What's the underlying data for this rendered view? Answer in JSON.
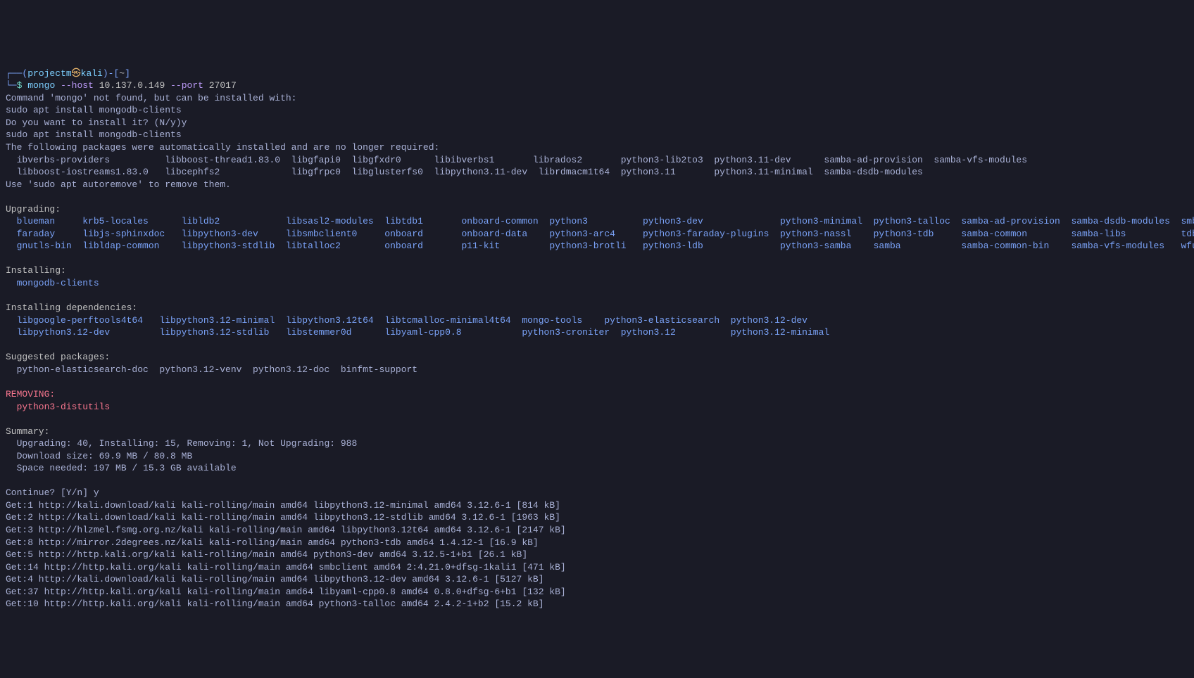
{
  "prompt": {
    "open": "┌──(",
    "user": "projectm",
    "at": "㉿",
    "host": "kali",
    "close": ")-[",
    "path": "~",
    "close2": "]",
    "line2_prefix": "└─",
    "dollar": "$"
  },
  "cmd": {
    "name": "mongo",
    "flag_host": "--host",
    "host_val": "10.137.0.149",
    "flag_port": "--port",
    "port_val": "27017"
  },
  "output": {
    "not_found": "Command 'mongo' not found, but can be installed with:",
    "install_hint": "sudo apt install mongodb-clients",
    "confirm_q": "Do you want to install it? (N/y)y",
    "install_cmd": "sudo apt install mongodb-clients",
    "autoremove_header": "The following packages were automatically installed and are no longer required:",
    "autoremove_row1": "  ibverbs-providers          libboost-thread1.83.0  libgfapi0  libgfxdr0      libibverbs1       librados2       python3-lib2to3  python3.11-dev      samba-ad-provision  samba-vfs-modules",
    "autoremove_row2": "  libboost-iostreams1.83.0   libcephfs2             libgfrpc0  libglusterfs0  libpython3.11-dev  librdmacm1t64  python3.11       python3.11-minimal  samba-dsdb-modules",
    "autoremove_hint": "Use 'sudo apt autoremove' to remove them.",
    "upgrading_header": "Upgrading:",
    "upgrading_row1": "  blueman     krb5-locales      libldb2            libsasl2-modules  libtdb1       onboard-common  python3          python3-dev              python3-minimal  python3-talloc  samba-ad-provision  samba-dsdb-modules  smbclient  winexe",
    "upgrading_row2": "  faraday     libjs-sphinxdoc   libpython3-dev     libsmbclient0     onboard       onboard-data    python3-arc4     python3-faraday-plugins  python3-nassl    python3-tdb     samba-common        samba-libs          tdb-tools",
    "upgrading_row3": "  gnutls-bin  libldap-common    libpython3-stdlib  libtalloc2        onboard       p11-kit         python3-brotli   python3-ldb              python3-samba    samba           samba-common-bin    samba-vfs-modules   wfuzz",
    "installing_header": "Installing:",
    "installing_row1": "  mongodb-clients",
    "deps_header": "Installing dependencies:",
    "deps_row1": "  libgoogle-perftools4t64   libpython3.12-minimal  libpython3.12t64  libtcmalloc-minimal4t64  mongo-tools    python3-elasticsearch  python3.12-dev",
    "deps_row2": "  libpython3.12-dev         libpython3.12-stdlib   libstemmer0d      libyaml-cpp0.8           python3-croniter  python3.12          python3.12-minimal",
    "suggested_header": "Suggested packages:",
    "suggested_row1": "  python-elasticsearch-doc  python3.12-venv  python3.12-doc  binfmt-support",
    "removing_header": "REMOVING:",
    "removing_row1": "  python3-distutils",
    "summary_header": "Summary:",
    "summary_row1": "  Upgrading: 40, Installing: 15, Removing: 1, Not Upgrading: 988",
    "summary_row2": "  Download size: 69.9 MB / 80.8 MB",
    "summary_row3": "  Space needed: 197 MB / 15.3 GB available",
    "continue_q": "Continue? [Y/n] y",
    "get1": "Get:1 http://kali.download/kali kali-rolling/main amd64 libpython3.12-minimal amd64 3.12.6-1 [814 kB]",
    "get2": "Get:2 http://kali.download/kali kali-rolling/main amd64 libpython3.12-stdlib amd64 3.12.6-1 [1963 kB]",
    "get3": "Get:3 http://hlzmel.fsmg.org.nz/kali kali-rolling/main amd64 libpython3.12t64 amd64 3.12.6-1 [2147 kB]",
    "get8": "Get:8 http://mirror.2degrees.nz/kali kali-rolling/main amd64 python3-tdb amd64 1.4.12-1 [16.9 kB]",
    "get5": "Get:5 http://http.kali.org/kali kali-rolling/main amd64 python3-dev amd64 3.12.5-1+b1 [26.1 kB]",
    "get14": "Get:14 http://http.kali.org/kali kali-rolling/main amd64 smbclient amd64 2:4.21.0+dfsg-1kali1 [471 kB]",
    "get4": "Get:4 http://kali.download/kali kali-rolling/main amd64 libpython3.12-dev amd64 3.12.6-1 [5127 kB]",
    "get37": "Get:37 http://http.kali.org/kali kali-rolling/main amd64 libyaml-cpp0.8 amd64 0.8.0+dfsg-6+b1 [132 kB]",
    "get10": "Get:10 http://http.kali.org/kali kali-rolling/main amd64 python3-talloc amd64 2.4.2-1+b2 [15.2 kB]"
  }
}
